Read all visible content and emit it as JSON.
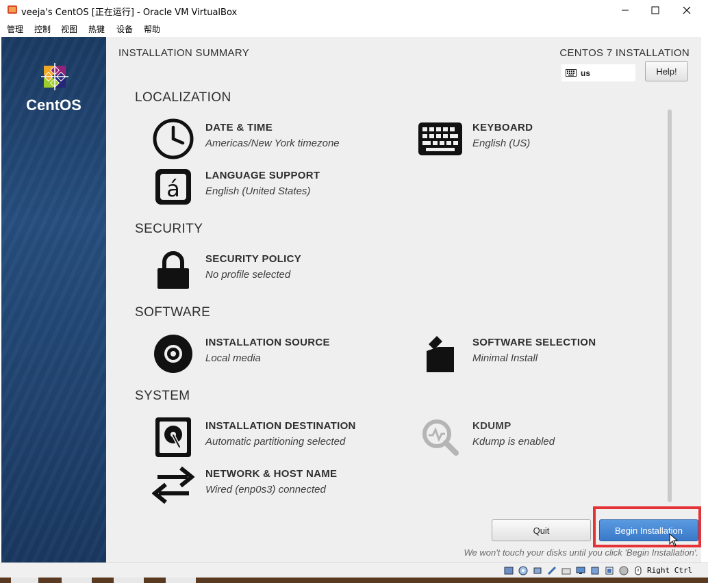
{
  "window": {
    "title": "veeja's CentOS [正在运行] - Oracle VM VirtualBox",
    "menu": [
      "管理",
      "控制",
      "视图",
      "热键",
      "设备",
      "帮助"
    ]
  },
  "installer": {
    "brand": "CentOS",
    "summary_label": "INSTALLATION SUMMARY",
    "product_title": "CENTOS 7 INSTALLATION",
    "keyboard_layout": "us",
    "help_label": "Help!",
    "sections": {
      "localization": "LOCALIZATION",
      "security": "SECURITY",
      "software": "SOFTWARE",
      "system": "SYSTEM"
    },
    "spokes": {
      "date_time": {
        "title": "DATE & TIME",
        "status": "Americas/New York timezone"
      },
      "keyboard": {
        "title": "KEYBOARD",
        "status": "English (US)"
      },
      "language": {
        "title": "LANGUAGE SUPPORT",
        "status": "English (United States)"
      },
      "security_policy": {
        "title": "SECURITY POLICY",
        "status": "No profile selected"
      },
      "install_source": {
        "title": "INSTALLATION SOURCE",
        "status": "Local media"
      },
      "software_selection": {
        "title": "SOFTWARE SELECTION",
        "status": "Minimal Install"
      },
      "install_dest": {
        "title": "INSTALLATION DESTINATION",
        "status": "Automatic partitioning selected"
      },
      "kdump": {
        "title": "KDUMP",
        "status": "Kdump is enabled"
      },
      "network": {
        "title": "NETWORK & HOST NAME",
        "status": "Wired (enp0s3) connected"
      }
    },
    "quit_label": "Quit",
    "begin_label": "Begin Installation",
    "disk_note": "We won't touch your disks until you click 'Begin Installation'."
  },
  "statusbar": {
    "host_key": "Right Ctrl"
  },
  "colors": {
    "begin_button": "#3a79c9",
    "highlight": "#e53237",
    "sidebar": "#20436f"
  }
}
